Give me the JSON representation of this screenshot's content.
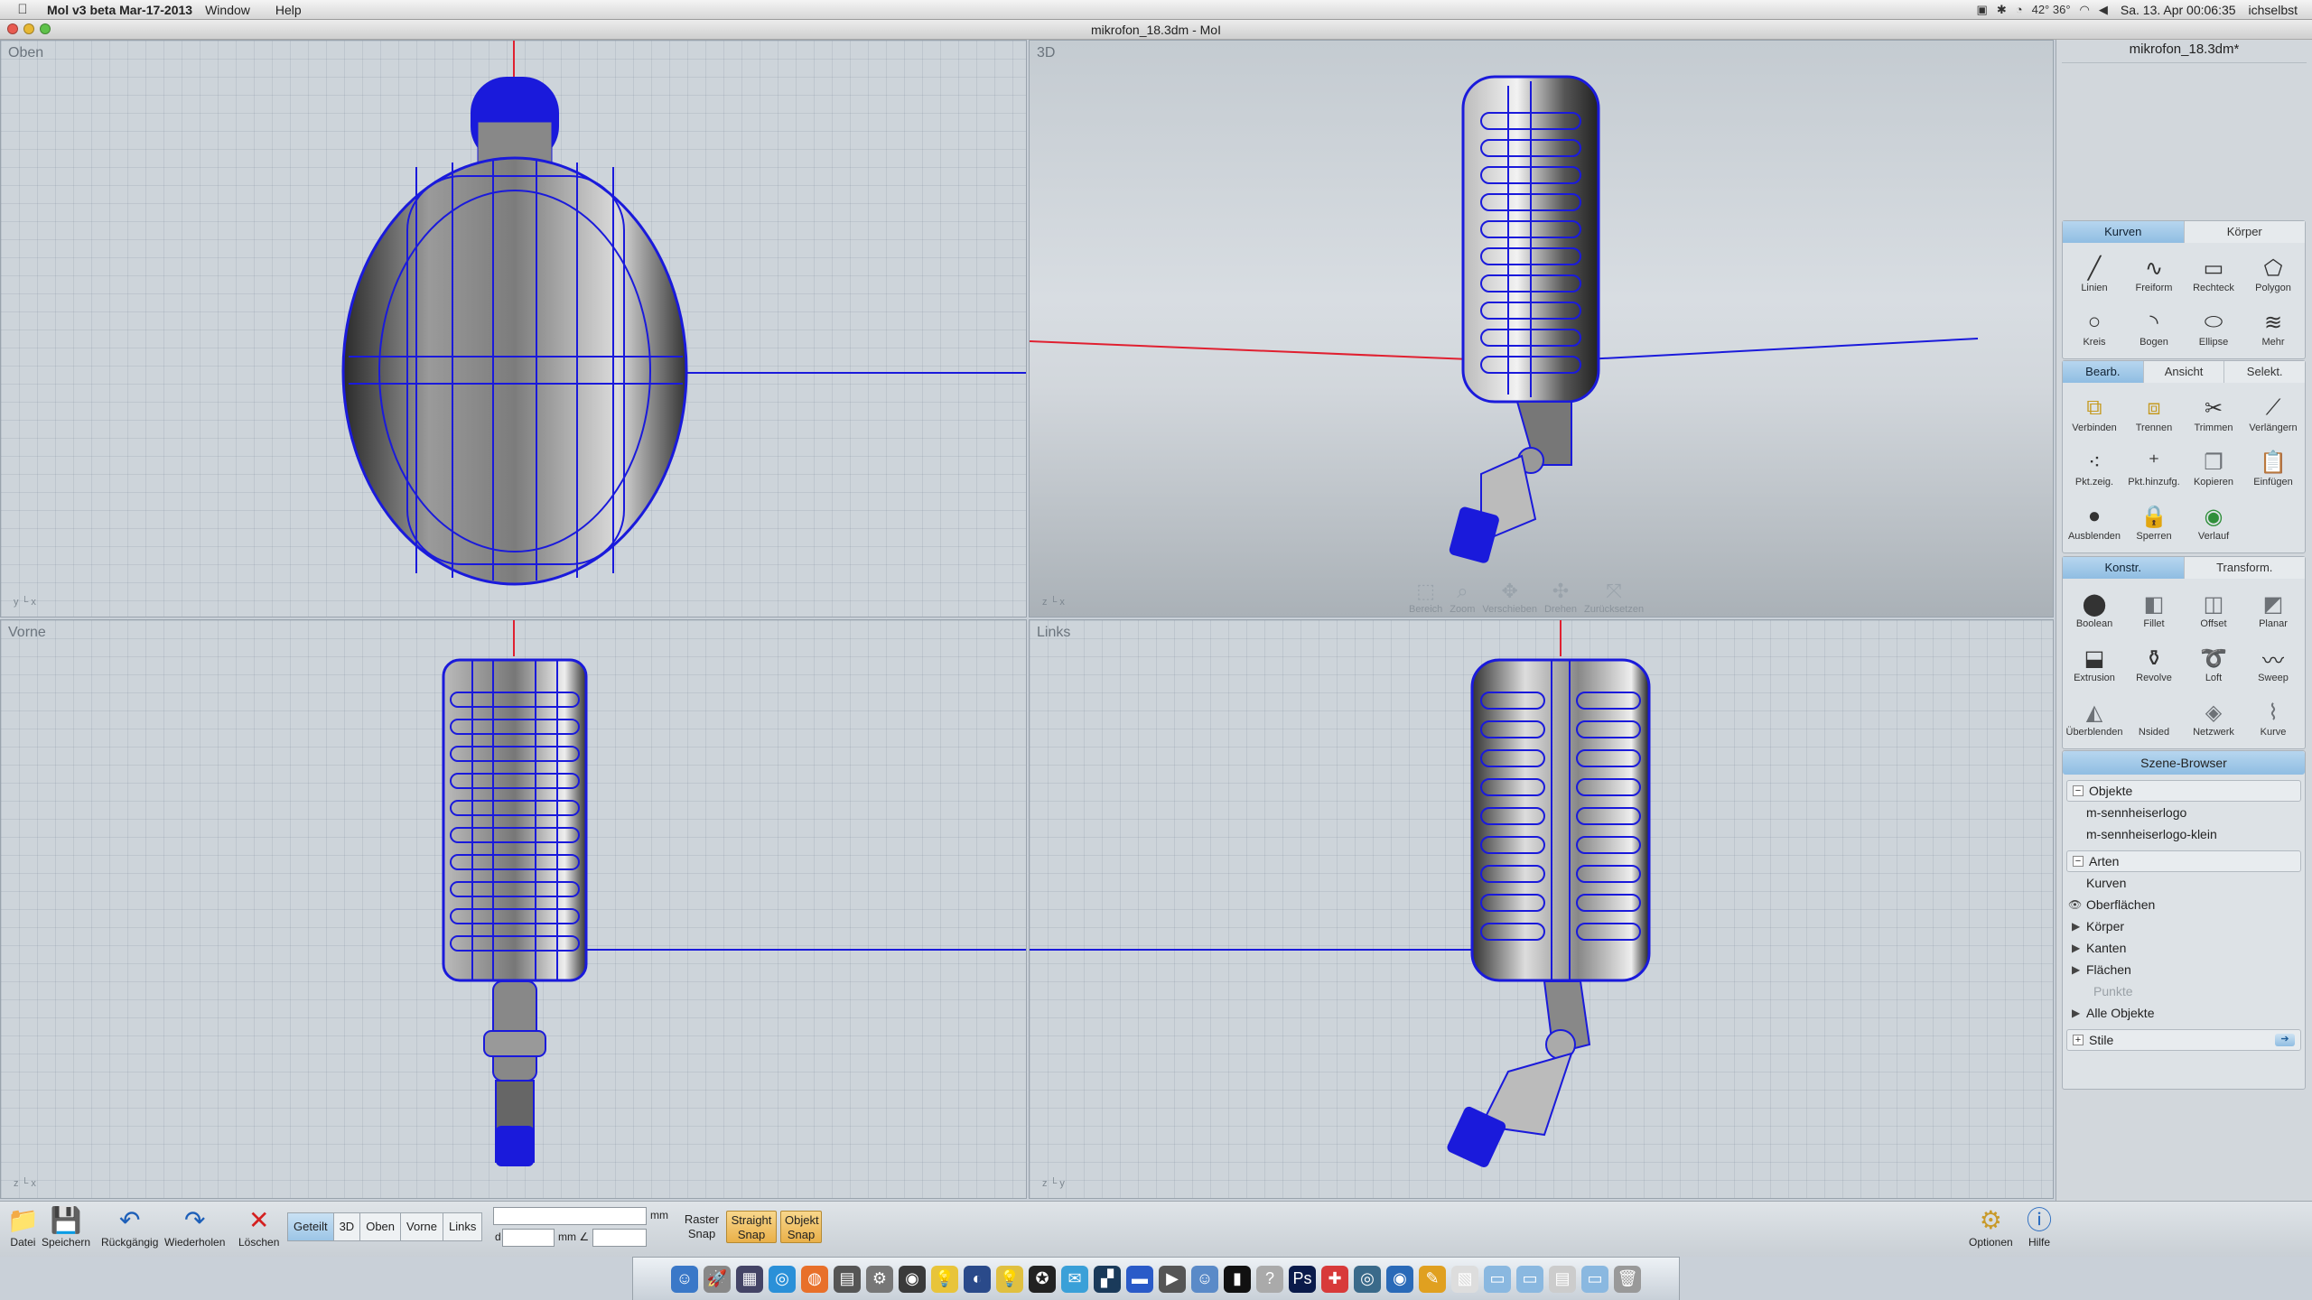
{
  "menubar": {
    "app_name": "Mol v3 beta Mar-17-2013",
    "menus": [
      "Window",
      "Help"
    ],
    "status_icons": [
      "42° 36°"
    ],
    "datetime": "Sa. 13. Apr  00:06:35",
    "user": "ichselbst"
  },
  "window": {
    "title": "mikrofon_18.3dm - MoI"
  },
  "viewports": {
    "top": {
      "label": "Oben",
      "axis": "y └ x"
    },
    "perspective": {
      "label": "3D",
      "axis": "z └ x",
      "nav": {
        "bereich": "Bereich",
        "zoom": "Zoom",
        "verschieben": "Verschieben",
        "drehen": "Drehen",
        "zuruecksetzen": "Zurücksetzen"
      }
    },
    "front": {
      "label": "Vorne",
      "axis": "z └ x"
    },
    "left": {
      "label": "Links",
      "axis": "z └ y"
    }
  },
  "right_panel": {
    "filename": "mikrofon_18.3dm*",
    "draw_tabs": {
      "kurven": "Kurven",
      "koerper": "Körper"
    },
    "draw_tools": {
      "linien": "Linien",
      "freiform": "Freiform",
      "rechteck": "Rechteck",
      "polygon": "Polygon",
      "kreis": "Kreis",
      "bogen": "Bogen",
      "ellipse": "Ellipse",
      "mehr": "Mehr"
    },
    "edit_tabs": {
      "bearb": "Bearb.",
      "ansicht": "Ansicht",
      "selekt": "Selekt."
    },
    "edit_tools": {
      "verbinden": "Verbinden",
      "trennen": "Trennen",
      "trimmen": "Trimmen",
      "verlaengern": "Verlängern",
      "pktzeig": "Pkt.zeig.",
      "pkthinzufg": "Pkt.hinzufg.",
      "kopieren": "Kopieren",
      "einfuegen": "Einfügen",
      "ausblenden": "Ausblenden",
      "sperren": "Sperren",
      "verlauf": "Verlauf"
    },
    "konstr_tabs": {
      "konstr": "Konstr.",
      "transform": "Transform."
    },
    "konstr_tools": {
      "boolean": "Boolean",
      "fillet": "Fillet",
      "offset": "Offset",
      "planar": "Planar",
      "extrusion": "Extrusion",
      "revolve": "Revolve",
      "loft": "Loft",
      "sweep": "Sweep",
      "ueberblenden": "Überblenden",
      "nsided": "Nsided",
      "netzwerk": "Netzwerk",
      "kurve": "Kurve"
    },
    "scene_browser": {
      "title": "Szene-Browser",
      "objekte_title": "Objekte",
      "objekte": [
        "m-sennheiserlogo",
        "m-sennheiserlogo-klein"
      ],
      "arten_title": "Arten",
      "arten": [
        "Kurven",
        "Oberflächen",
        "Körper",
        "Kanten",
        "Flächen",
        "Punkte",
        "Alle Objekte"
      ],
      "stile_title": "Stile"
    }
  },
  "bottom_toolbar": {
    "datei": "Datei",
    "speichern": "Speichern",
    "rueckgaengig": "Rückgängig",
    "wiederholen": "Wiederholen",
    "loeschen": "Löschen",
    "views": {
      "geteilt": "Geteilt",
      "three_d": "3D",
      "oben": "Oben",
      "vorne": "Vorne",
      "links": "Links"
    },
    "unit_mm": "mm",
    "d_label": "d",
    "unit_mm2": "mm ∠",
    "raster_snap": "Raster Snap",
    "straight_snap": "Straight Snap",
    "objekt_snap": "Objekt Snap",
    "optionen": "Optionen",
    "hilfe": "Hilfe"
  },
  "colors": {
    "wire": "#1a1adb",
    "x_axis": "#e02030",
    "accent": "#8fbde2",
    "snap_on": "#e9b049"
  }
}
